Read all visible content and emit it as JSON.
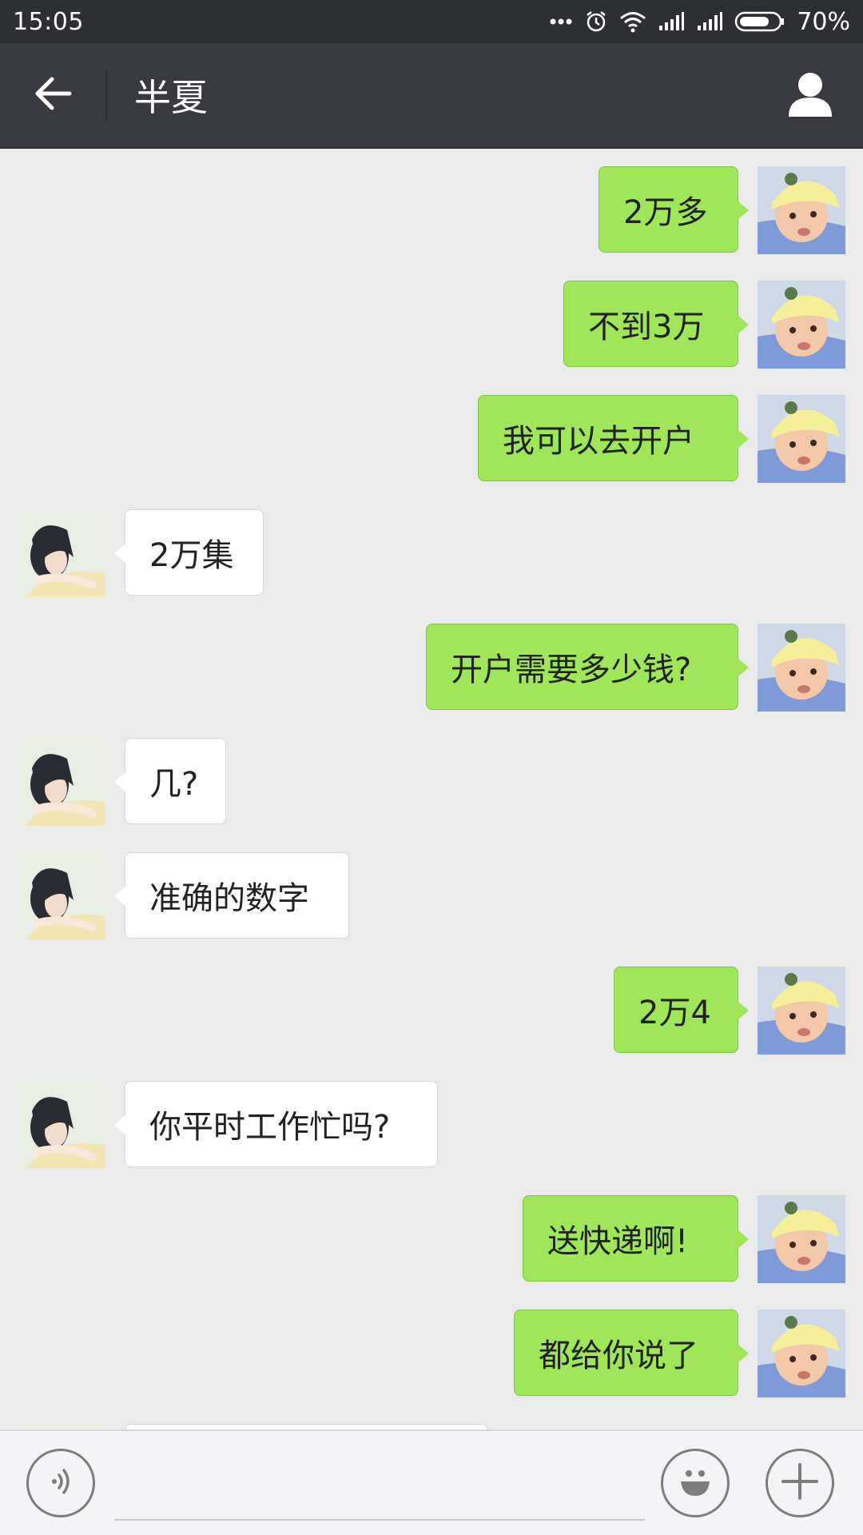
{
  "status_bar": {
    "time": "15:05",
    "battery": "70%",
    "icons": [
      "dots-icon",
      "alarm-icon",
      "wifi-icon",
      "signal-icon",
      "signal-icon",
      "battery-icon"
    ]
  },
  "header": {
    "title": "半夏",
    "left_icon": "back-arrow-icon",
    "right_icon": "profile-icon"
  },
  "messages": [
    {
      "side": "self",
      "text": "2万多"
    },
    {
      "side": "self",
      "text": "不到3万"
    },
    {
      "side": "self",
      "text": "我可以去开户"
    },
    {
      "side": "other",
      "text": "2万集"
    },
    {
      "side": "self",
      "text": "开户需要多少钱?"
    },
    {
      "side": "other",
      "text": "几?"
    },
    {
      "side": "other",
      "text": "准确的数字"
    },
    {
      "side": "self",
      "text": "2万4"
    },
    {
      "side": "other",
      "text": "你平时工作忙吗?"
    },
    {
      "side": "self",
      "text": "送快递啊!"
    },
    {
      "side": "self",
      "text": "都给你说了"
    },
    {
      "side": "other",
      "text": ""
    }
  ],
  "input_bar": {
    "placeholder": "",
    "left_icon": "voice-icon",
    "emoji_icon": "emoji-icon",
    "plus_icon": "plus-icon"
  },
  "colors": {
    "status_bar": "#2d2f32",
    "header": "#393a3f",
    "background": "#ebebeb",
    "self_bubble": "#9fe658",
    "other_bubble": "#ffffff"
  }
}
